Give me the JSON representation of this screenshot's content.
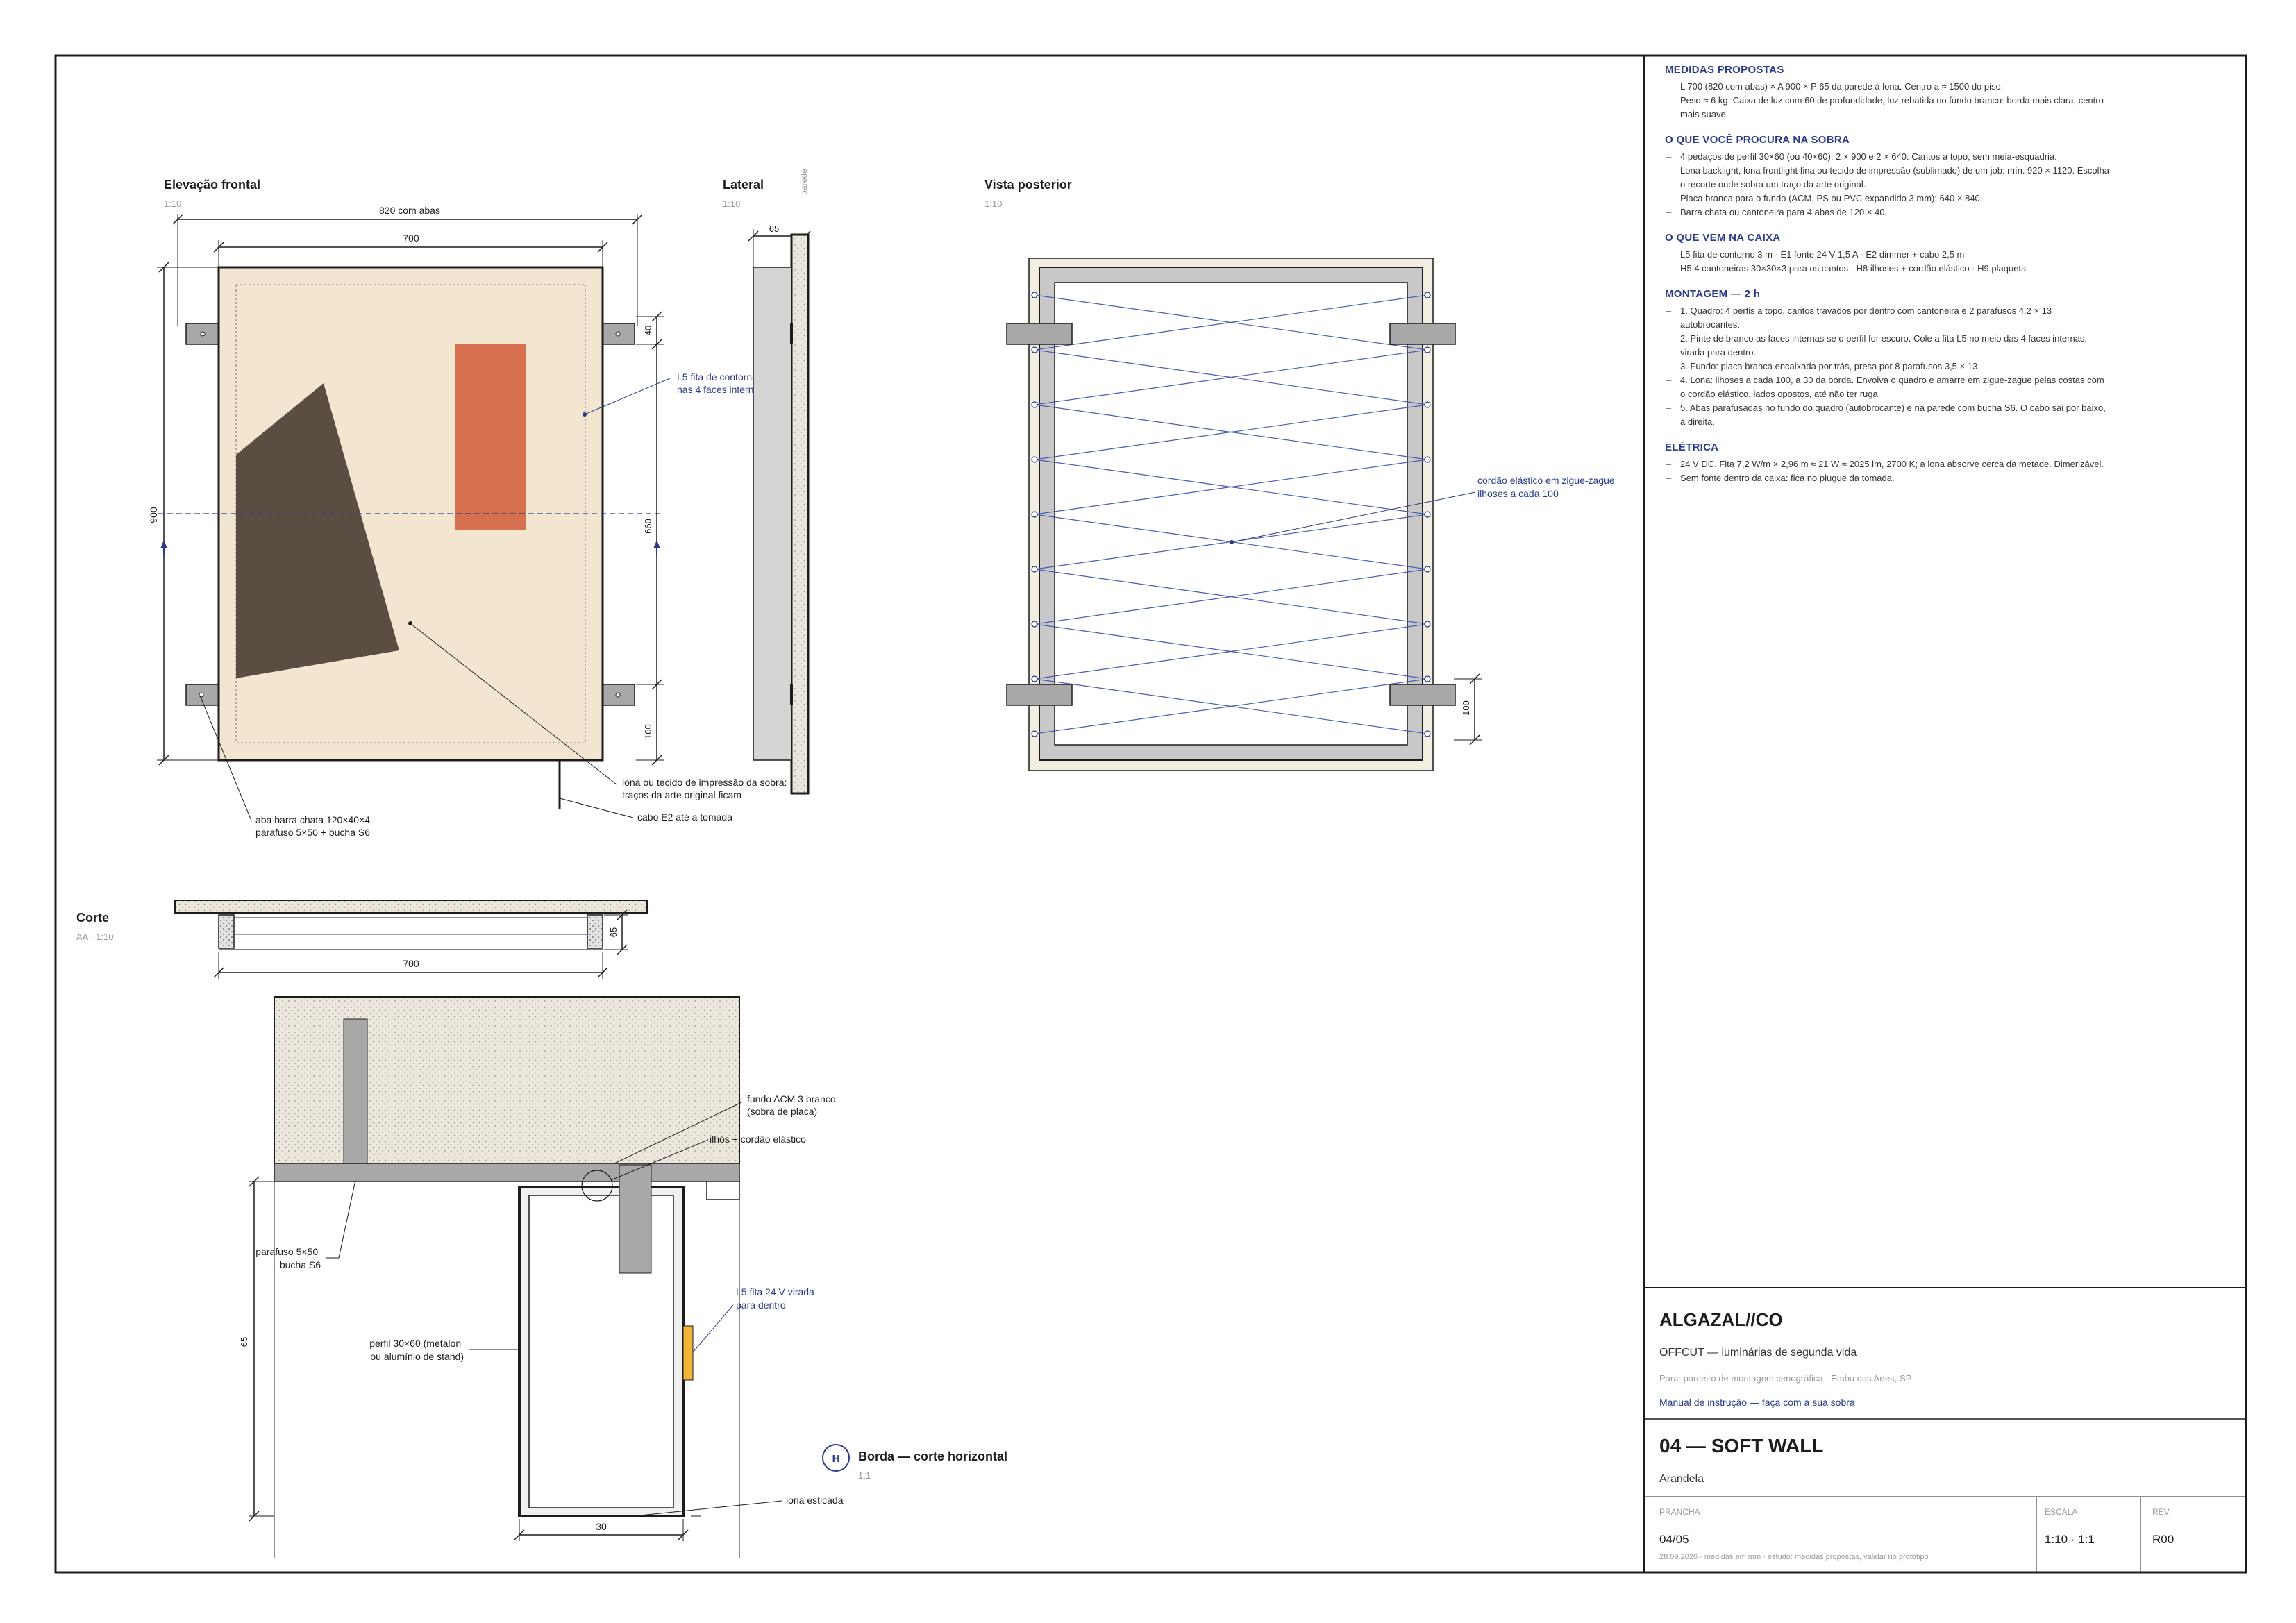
{
  "views": {
    "front": {
      "title": "Elevação frontal",
      "scale": "1:10"
    },
    "lateral": {
      "title": "Lateral",
      "scale": "1:10",
      "wall_label": "parede"
    },
    "rear": {
      "title": "Vista posterior",
      "scale": "1:10"
    },
    "section": {
      "title": "Corte",
      "scale": "AA · 1:10"
    },
    "detail": {
      "badge": "H",
      "title": "Borda — corte horizontal",
      "scale": "1:1"
    }
  },
  "dimensions": {
    "width_with_tabs": "820 com abas",
    "width": "700",
    "tab_height": "40",
    "height": "900",
    "inner_height": "660",
    "bottom_offset": "100",
    "depth": "65",
    "rear_offset": "100",
    "section_width": "700",
    "section_depth": "65",
    "detail_depth": "65",
    "detail_width": "30"
  },
  "annotations": {
    "led_strip": [
      "L5 fita de contorno",
      "nas 4 faces internas"
    ],
    "fabric": [
      "lona ou tecido de impressão da sobra:",
      "traços da arte original ficam"
    ],
    "cable": "cabo E2 até a tomada",
    "tab": [
      "aba barra chata 120×40×4",
      "parafuso 5×50 + bucha S6"
    ],
    "elastic": [
      "cordão elástico em zigue-zague",
      "ilhoses a cada 100"
    ],
    "backing": [
      "fundo ACM 3 branco",
      "(sobra de placa)"
    ],
    "grommet": "ilhós + cordão elástico",
    "screw": [
      "parafuso 5×50",
      "+ bucha S6"
    ],
    "led_24v": [
      "L5 fita 24 V virada",
      "para dentro"
    ],
    "profile": [
      "perfil 30×60 (metalon",
      "ou alumínio de stand)"
    ],
    "stretched": "lona esticada"
  },
  "notes": [
    {
      "heading": "MEDIDAS PROPOSTAS",
      "items": [
        "L 700 (820 com abas) × A 900 × P 65 da parede à lona. Centro a ≈ 1500 do piso.",
        "Peso ≈ 6 kg. Caixa de luz com 60 de profundidade, luz rebatida no fundo branco: borda mais clara, centro mais suave."
      ]
    },
    {
      "heading": "O QUE VOCÊ PROCURA NA SOBRA",
      "items": [
        "4 pedaços de perfil 30×60 (ou 40×60): 2 × 900 e 2 × 640. Cantos a topo, sem meia-esquadria.",
        "Lona backlight, lona frontlight fina ou tecido de impressão (sublimado) de um job: mín. 920 × 1120. Escolha o recorte onde sobra um traço da arte original.",
        "Placa branca para o fundo (ACM, PS ou PVC expandido 3 mm): 640 × 840.",
        "Barra chata ou cantoneira para 4 abas de 120 × 40."
      ]
    },
    {
      "heading": "O QUE VEM NA CAIXA",
      "items": [
        "L5 fita de contorno 3 m · E1 fonte 24 V 1,5 A · E2 dimmer + cabo 2,5 m",
        "H5 4 cantoneiras 30×30×3 para os cantos · H8 ilhoses + cordão elástico · H9 plaqueta"
      ]
    },
    {
      "heading": "MONTAGEM — 2 h",
      "items": [
        "1. Quadro: 4 perfis a topo, cantos travados por dentro com cantoneira e 2 parafusos 4,2 × 13 autobrocantes.",
        "2. Pinte de branco as faces internas se o perfil for escuro. Cole a fita L5 no meio das 4 faces internas, virada para dentro.",
        "3. Fundo: placa branca encaixada por trás, presa por 8 parafusos 3,5 × 13.",
        "4. Lona: ilhoses a cada 100, a 30 da borda. Envolva o quadro e amarre em zigue-zague pelas costas com o cordão elástico, lados opostos, até não ter ruga.",
        "5. Abas parafusadas no fundo do quadro (autobrocante) e na parede com bucha S6. O cabo sai por baixo, à direita."
      ]
    },
    {
      "heading": "ELÉTRICA",
      "items": [
        "24 V DC. Fita 7,2 W/m × 2,96 m ≈ 21 W ≈ 2025 lm, 2700 K; a lona absorve cerca da metade. Dimerizável.",
        "Sem fonte dentro da caixa: fica no plugue da tomada."
      ]
    }
  ],
  "titleblock": {
    "company": "ALGAZAL//CO",
    "subtitle": "OFFCUT — luminárias de segunda vida",
    "client": "Para: parceiro de montagem cenográfica · Embu das Artes, SP",
    "manual": "Manual de instrução — faça com a sua sobra",
    "sheet_title": "04 — SOFT WALL",
    "sheet_subtitle": "Arandela",
    "labels": {
      "sheet": "PRANCHA",
      "scale": "ESCALA",
      "rev": "REV."
    },
    "sheet_no": "04/05",
    "scale": "1:10 · 1:1",
    "rev": "R00",
    "footnote": "28.09.2026 · medidas em mm · estudo: medidas propostas, validar no protótipo"
  },
  "colors": {
    "ink": "#1c1c1c",
    "accent": "#2a3a8a",
    "canvas": "#f2e6d0",
    "dark_shape": "#5a4e42",
    "orange_shape": "#d6704e",
    "led": "#f2b43a",
    "steel": "#a8a8a8"
  }
}
